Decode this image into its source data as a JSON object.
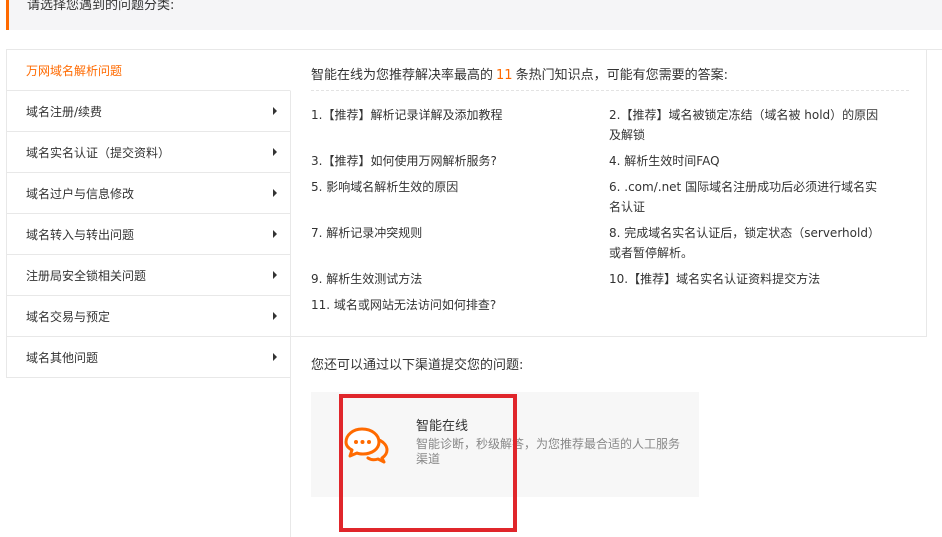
{
  "header": {
    "label": "请选择您遇到的问题分类:"
  },
  "sidebar": {
    "items": [
      {
        "label": "万网域名解析问题"
      },
      {
        "label": "域名注册/续费"
      },
      {
        "label": "域名实名认证（提交资料）"
      },
      {
        "label": "域名过户与信息修改"
      },
      {
        "label": "域名转入与转出问题"
      },
      {
        "label": "注册局安全锁相关问题"
      },
      {
        "label": "域名交易与预定"
      },
      {
        "label": "域名其他问题"
      }
    ]
  },
  "main": {
    "heading_prefix": "智能在线为您推荐解决率最高的",
    "heading_count": "11",
    "heading_suffix": "条热门知识点，可能有您需要的答案:",
    "articles": [
      {
        "text": "1.【推荐】解析记录详解及添加教程"
      },
      {
        "text": "2.【推荐】域名被锁定冻结（域名被 hold）的原因及解锁"
      },
      {
        "text": "3.【推荐】如何使用万网解析服务?"
      },
      {
        "text": "4. 解析生效时间FAQ"
      },
      {
        "text": "5. 影响域名解析生效的原因"
      },
      {
        "text": "6. .com/.net 国际域名注册成功后必须进行域名实名认证"
      },
      {
        "text": "7. 解析记录冲突规则"
      },
      {
        "text": "8. 完成域名实名认证后，锁定状态（serverhold）或者暂停解析。"
      },
      {
        "text": "9. 解析生效测试方法"
      },
      {
        "text": "10.【推荐】域名实名认证资料提交方法"
      },
      {
        "text": "11. 域名或网站无法访问如何排查?"
      }
    ]
  },
  "channels": {
    "title": "您还可以通过以下渠道提交您的问题:",
    "card": {
      "icon": "chat-bubbles-icon",
      "title": "智能在线",
      "desc": "智能诊断，秒级解答，为您推荐最合适的人工服务渠道"
    }
  },
  "colors": {
    "accent": "#ff6a00",
    "highlight": "#e0262b",
    "text": "#333333",
    "muted": "#888888",
    "border": "#e8e8e8"
  }
}
